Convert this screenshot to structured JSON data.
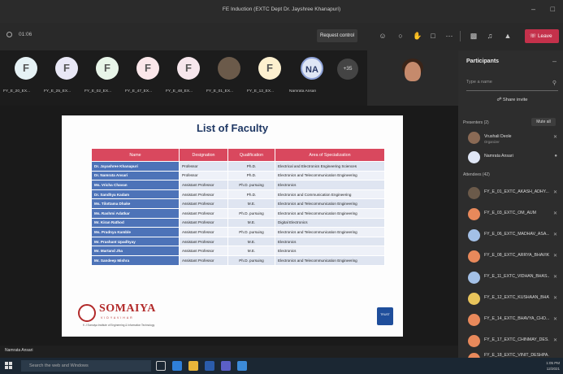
{
  "window": {
    "title": "FE Induction (EXTC Dept Dr. Jayshree Khanapuri)",
    "controls": [
      "–",
      "□"
    ]
  },
  "callbar": {
    "timer": "01:06",
    "request_control_label": "Request control",
    "leave_label": "Leave"
  },
  "participant_tiles": [
    {
      "initial": "F",
      "label": "FY_E_20_EX...",
      "color": "#e6f2f5"
    },
    {
      "initial": "F",
      "label": "FY_E_25_EX...",
      "color": "#e9e8f6"
    },
    {
      "initial": "F",
      "label": "FY_E_02_EX...",
      "color": "#e8f5e9"
    },
    {
      "initial": "F",
      "label": "FY_E_47_EX...",
      "color": "#fbe7ea"
    },
    {
      "initial": "F",
      "label": "FY_E_48_EX...",
      "color": "#f6e6ec"
    },
    {
      "initial": "",
      "label": "FY_E_01_EX...",
      "color": "#6b5a4a"
    },
    {
      "initial": "F",
      "label": "FY_E_12_EX...",
      "color": "#fdf0cf"
    },
    {
      "initial": "NA",
      "label": "Namrata Ansari",
      "color": "#dfe6f5"
    }
  ],
  "more_count": "+35",
  "slide": {
    "title": "List of Faculty",
    "columns": [
      "Name",
      "Designation",
      "Qualification",
      "Area of Specialization"
    ],
    "rows": [
      [
        "Dr. Jayashree Khanapuri",
        "Professor",
        "Ph.D.",
        "Electrical and Electronics Engineering Sciences"
      ],
      [
        "Dr. Namrata Ansari",
        "Professor",
        "Ph.D.",
        "Electronics and Telecommunication Engineering"
      ],
      [
        "Ms. Vricha Chavan",
        "Assistant Professor",
        "Ph.D. pursuing",
        "Electronics"
      ],
      [
        "Dr. Sandhya Kadam",
        "Assistant Professor",
        "Ph.D.",
        "Electronics and Communication Engineering"
      ],
      [
        "Ms. Tilottama Dhake",
        "Assistant Professor",
        "M.E.",
        "Electronics and Telecommunication Engineering"
      ],
      [
        "Ms. Rashmi Adatkar",
        "Assistant Professor",
        "Ph.D. pursuing",
        "Electronics and Telecommunication Engineering"
      ],
      [
        "Mr. Kiran Rathod",
        "Assistant Professor",
        "M.E.",
        "Digital Electronics"
      ],
      [
        "Ms. Pradnya Kamble",
        "Assistant Professor",
        "Ph.D. pursuing",
        "Electronics and Telecommunication Engineering"
      ],
      [
        "Mr. Prashant Upadhyay",
        "Assistant Professor",
        "M.E.",
        "Electronics"
      ],
      [
        "Mr. Martand Jha",
        "Assistant Professor",
        "M.E.",
        "Electronics"
      ],
      [
        "Mr. Sandeep Mishra",
        "Assistant Professor",
        "Ph.D. pursuing",
        "Electronics and Telecommunication Engineering"
      ]
    ],
    "logo_word": "SOMAIYA",
    "logo_sub": "VIDYAVIHAR",
    "logo_inst": "K J Somaiya Institute of Engineering & Information Technology",
    "trust_label": "TRUST"
  },
  "presenter_label": "Namrata Ansari",
  "panel": {
    "title": "Participants",
    "search_placeholder": "Type a name",
    "share_invite": "Share invite",
    "presenters_label": "Presenters (2)",
    "mute_all": "Mute all",
    "attendees_label": "Attendees (42)",
    "presenters": [
      {
        "name": "Vrushali Deole",
        "role": "Organizer",
        "color": "#8a6a55"
      },
      {
        "name": "Namrata Ansari",
        "role": "",
        "color": "#dfe6f5"
      }
    ],
    "attendees": [
      {
        "name": "FY_E_01_EXTC_AKASH_ADHY...",
        "color": "#6b5a4a"
      },
      {
        "name": "FY_E_03_EXTC_OM_AUM",
        "color": "#e8895b"
      },
      {
        "name": "FY_E_06_EXTC_MADHAV_ASA...",
        "color": "#a3c0e6"
      },
      {
        "name": "FY_E_08_EXTC_ARRYA_BHAVIK",
        "color": "#e8895b"
      },
      {
        "name": "FY_E_11_EXTC_VIDHAN_BHAS...",
        "color": "#a3c0e6"
      },
      {
        "name": "FY_E_12_EXTC_KUSHAAN_BHAT",
        "color": "#e8c45b"
      },
      {
        "name": "FY_E_14_EXTC_BHAVYA_CHO...",
        "color": "#e8895b"
      },
      {
        "name": "FY_E_17_EXTC_CHINMAY_DES...",
        "color": "#e8895b"
      },
      {
        "name": "FY_E_18_EXTC_VINIT_DESHPA...",
        "color": "#e8895b"
      }
    ]
  },
  "taskbar": {
    "search_placeholder": "Search the web and Windows",
    "time": "1:05 PM",
    "date": "12/2021"
  }
}
